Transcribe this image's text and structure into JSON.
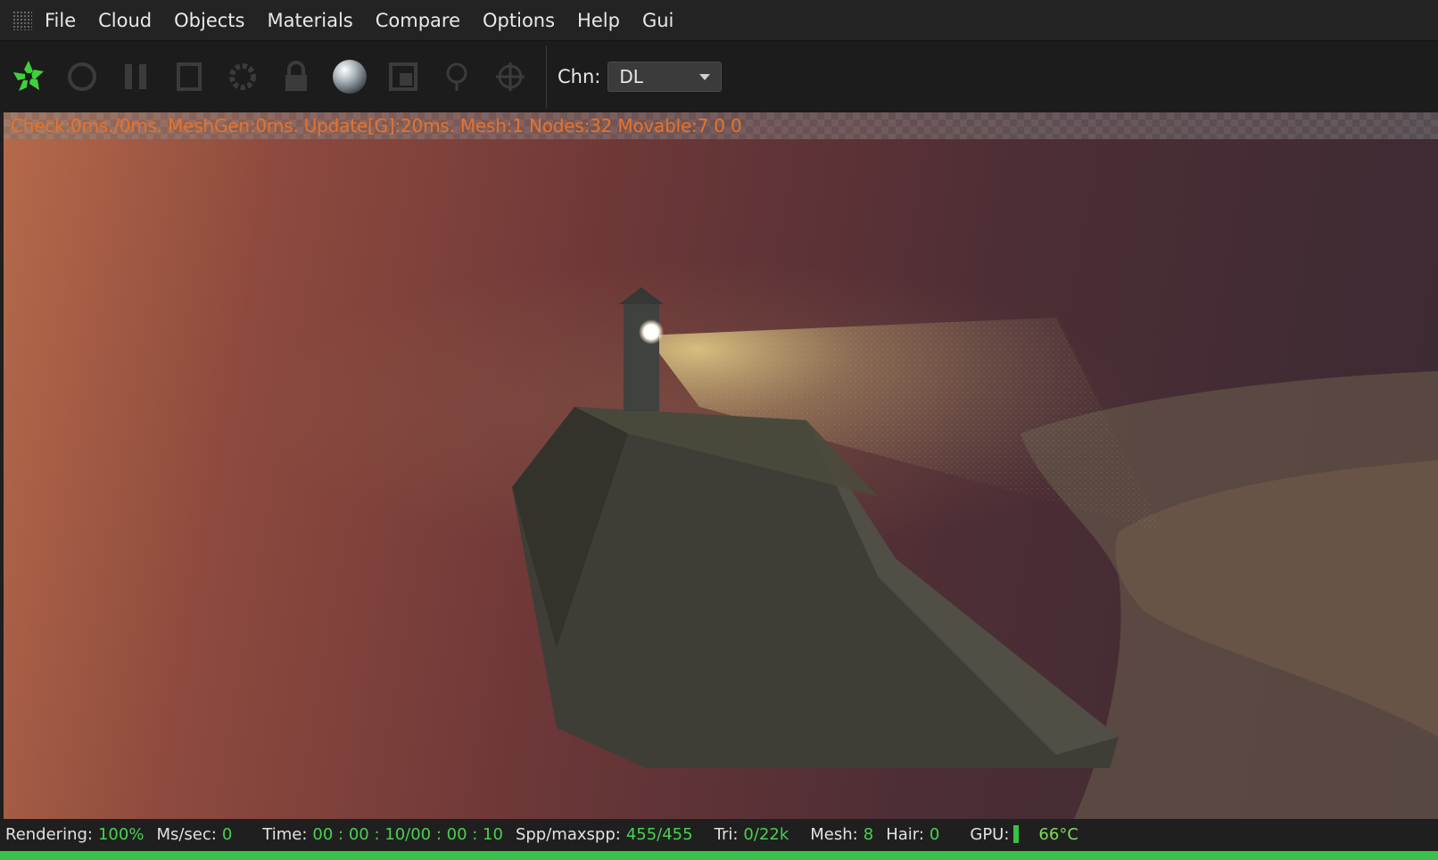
{
  "menu": [
    "File",
    "Cloud",
    "Objects",
    "Materials",
    "Compare",
    "Options",
    "Help",
    "Gui"
  ],
  "toolbar": {
    "icons": [
      "octane-logo-icon",
      "restart-icon",
      "pause-icon",
      "stop-icon",
      "settings-icon",
      "lock-icon",
      "material-ball-icon",
      "region-render-icon",
      "pick-focus-icon",
      "pick-white-balance-icon"
    ],
    "channel_label": "Chn:",
    "channel_value": "DL"
  },
  "viewport": {
    "stats": "Check:0ms./0ms. MeshGen:0ms. Update[G]:20ms. Mesh:1 Nodes:32 Movable:7  0 0"
  },
  "status": {
    "rendering_label": "Rendering:",
    "rendering_value": "100%",
    "mssec_label": "Ms/sec:",
    "mssec_value": "0",
    "time_label": "Time:",
    "time_value": "00 : 00 : 10/00 : 00 : 10",
    "spp_label": "Spp/maxspp:",
    "spp_value": "455/455",
    "tri_label": "Tri:",
    "tri_value": "0/22k",
    "mesh_label": "Mesh:",
    "mesh_value": "8",
    "hair_label": "Hair:",
    "hair_value": "0",
    "gpu_label": "GPU:",
    "gpu_temp": "66°C"
  },
  "progress": 1.0,
  "colors": {
    "accent_green": "#49d14f",
    "stats_orange": "#e8732a"
  }
}
